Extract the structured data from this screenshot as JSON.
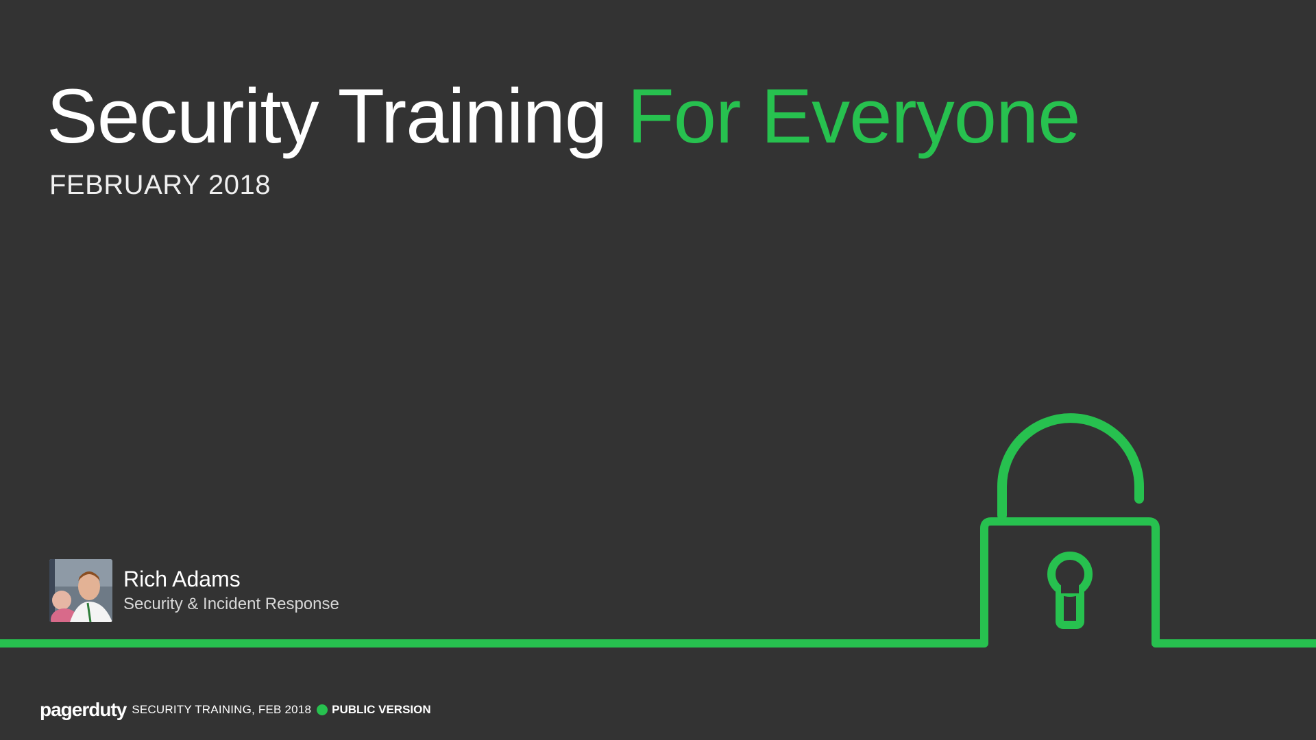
{
  "slide": {
    "title_main": "Security Training",
    "title_accent": "For Everyone",
    "subtitle": "FEBRUARY 2018"
  },
  "presenter": {
    "name": "Rich Adams",
    "role": "Security & Incident Response"
  },
  "footer": {
    "brand": "pagerduty",
    "text": "SECURITY TRAINING, FEB 2018",
    "badge": "PUBLIC VERSION"
  },
  "colors": {
    "background": "#333333",
    "accent": "#27c14f",
    "text": "#ffffff"
  },
  "icons": {
    "lock": "padlock-icon",
    "avatar": "presenter-photo"
  }
}
